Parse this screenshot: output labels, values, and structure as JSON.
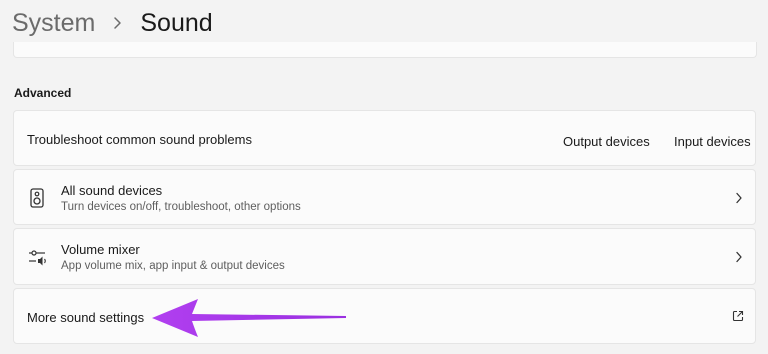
{
  "breadcrumb": {
    "parent": "System",
    "current": "Sound"
  },
  "advanced": {
    "section_label": "Advanced",
    "troubleshoot": {
      "label": "Troubleshoot common sound problems",
      "output_link": "Output devices",
      "input_link": "Input devices"
    },
    "all_devices": {
      "title": "All sound devices",
      "subtitle": "Turn devices on/off, troubleshoot, other options",
      "icon": "speaker-icon"
    },
    "volume_mixer": {
      "title": "Volume mixer",
      "subtitle": "App volume mix, app input & output devices",
      "icon": "volume-mixer-icon"
    },
    "more_settings": {
      "label": "More sound settings",
      "icon": "external-link-icon"
    }
  },
  "annotation": {
    "arrow_color": "#a93be8",
    "direction": "left"
  }
}
